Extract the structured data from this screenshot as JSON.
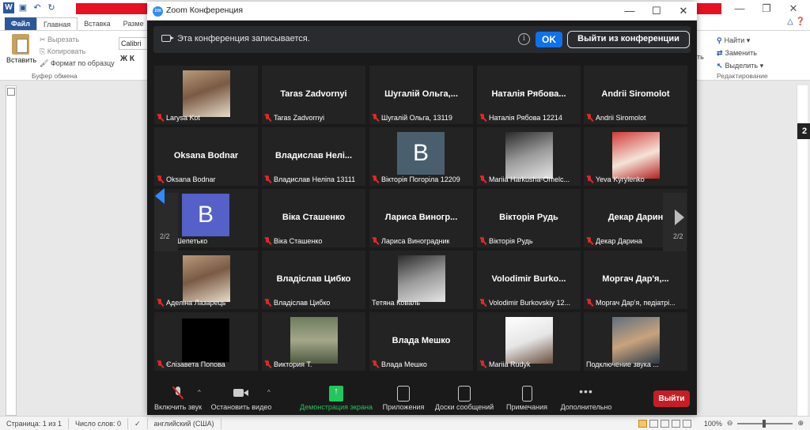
{
  "word": {
    "tabs": [
      "Файл",
      "Главная",
      "Вставка",
      "Разме"
    ],
    "clipboard": {
      "paste": "Вставить",
      "cut": "Вырезать",
      "copy": "Копировать",
      "format_painter": "Формат по образцу",
      "group": "Буфер обмена"
    },
    "font_name": "Calibri (O",
    "font_format": "Ж  К",
    "editing": {
      "find": "Найти",
      "replace": "Заменить",
      "select": "Выделить",
      "group": "Редактирование"
    },
    "styles_partial": "ить",
    "badge": "2",
    "status": {
      "page": "Страница: 1 из 1",
      "words": "Число слов: 0",
      "language": "английский (США)",
      "zoom": "100%"
    }
  },
  "zoom": {
    "title": "Zoom Конференция",
    "banner": {
      "recording_text": "Эта конференция записывается.",
      "ok": "OK",
      "leave_meeting": "Выйти из конференции"
    },
    "page_left": "2/2",
    "page_right": "2/2",
    "tiles": [
      [
        {
          "big": "",
          "label": "Larysa Kot",
          "kind": "photo",
          "mic": true
        },
        {
          "big": "Taras Zadvornyi",
          "label": "Taras Zadvornyi",
          "kind": "name",
          "mic": true
        },
        {
          "big": "Шугалій Ольга,...",
          "label": "Шугалій Ольга, 13119",
          "kind": "name",
          "mic": true
        },
        {
          "big": "Наталія Рябова...",
          "label": "Наталія Рябова 12214",
          "kind": "name",
          "mic": true
        },
        {
          "big": "Andrii Siromolot",
          "label": "Andrii Siromolot",
          "kind": "name",
          "mic": true
        }
      ],
      [
        {
          "big": "Oksana Bodnar",
          "label": "Oksana Bodnar",
          "kind": "name",
          "mic": true
        },
        {
          "big": "Владислав  Нелі...",
          "label": "Владислав Неліпа 13111",
          "kind": "name",
          "mic": true
        },
        {
          "big": "B",
          "label": "Вікторія Погоріла 12209",
          "kind": "avatar",
          "mic": true
        },
        {
          "big": "",
          "label": "Mariia Harkusha-Omelc...",
          "kind": "photo-bw",
          "mic": true
        },
        {
          "big": "",
          "label": "Yeva Kyrylenko",
          "kind": "photo-red",
          "mic": true
        }
      ],
      [
        {
          "big": "B",
          "label": "оніка Шепетько",
          "kind": "avatar-blue",
          "mic": false
        },
        {
          "big": "Віка Сташенко",
          "label": "Віка Сташенко",
          "kind": "name",
          "mic": true
        },
        {
          "big": "Лариса  Виногр...",
          "label": "Лариса Виноградник",
          "kind": "name",
          "mic": true
        },
        {
          "big": "Вікторія Рудь",
          "label": "Вікторія Рудь",
          "kind": "name",
          "mic": true
        },
        {
          "big": "Декар Дарин",
          "label": "Декар Дарина",
          "kind": "name",
          "mic": true
        }
      ],
      [
        {
          "big": "",
          "label": "Аделіна Лазарець",
          "kind": "photo",
          "mic": true
        },
        {
          "big": "Владіслав Цибко",
          "label": "Владіслав Цибко",
          "kind": "name",
          "mic": true
        },
        {
          "big": "",
          "label": "Тетяна Коваль",
          "kind": "photo-bw",
          "mic": false
        },
        {
          "big": "Volodimir  Burko...",
          "label": "Volodimir Burkovskiy 12...",
          "kind": "name",
          "mic": true
        },
        {
          "big": "Моргач  Дар'я,...",
          "label": "Моргач Дар'я, педіатрі...",
          "kind": "name",
          "mic": true
        }
      ],
      [
        {
          "big": "",
          "label": "Єлізавета Попова",
          "kind": "black",
          "mic": true
        },
        {
          "big": "",
          "label": "Виктория Т.",
          "kind": "photo-forest",
          "mic": true
        },
        {
          "big": "Влада Мешко",
          "label": "Влада Мешко",
          "kind": "name",
          "mic": true
        },
        {
          "big": "",
          "label": "Mariia Rudyk",
          "kind": "photo-white",
          "mic": true
        },
        {
          "big": "",
          "label": "Подключение звука ...",
          "kind": "photo-room",
          "mic": false
        }
      ]
    ],
    "toolbar": {
      "unmute": "Включить звук",
      "start_video": "Остановить видео",
      "share": "Демонстрация экрана",
      "apps": "Приложения",
      "whiteboards": "Доски сообщений",
      "notes": "Примечания",
      "more": "Дополнительно",
      "leave": "Выйти"
    },
    "colors": {
      "accent": "#0e72ed",
      "leave": "#c61e27",
      "share": "#22c55e",
      "muted": "#e02828"
    }
  }
}
